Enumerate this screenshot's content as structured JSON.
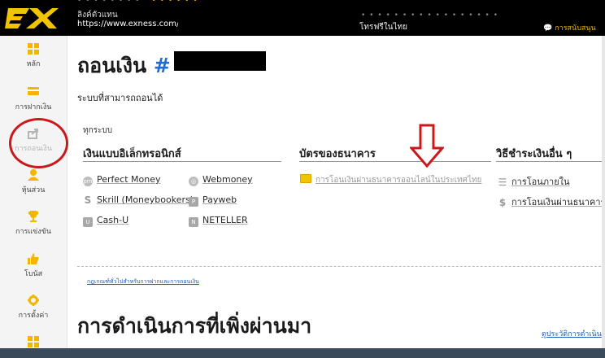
{
  "header": {
    "top_text": "• • • • • • • •",
    "top_text_highlight": "• • • • • •",
    "link_label": "ลิงค์ตัวแทน",
    "link_url": "https://www.exness.com/a",
    "dots": "• • • • • • • • • • • • • • • • •",
    "phone": "โทรฟรีในไทย",
    "support": "การสนับสนุน"
  },
  "sidebar": {
    "items": [
      {
        "label": "หลัก",
        "icon": "grid-icon"
      },
      {
        "label": "การฝากเงิน",
        "icon": "card-icon"
      },
      {
        "label": "การถอนเงิน",
        "icon": "share-out-icon"
      },
      {
        "label": "หุ้นส่วน",
        "icon": "person-icon"
      },
      {
        "label": "การแข่งขัน",
        "icon": "trophy-icon"
      },
      {
        "label": "โบนัส",
        "icon": "thumbs-up-icon"
      },
      {
        "label": "การตั้งค่า",
        "icon": "gear-icon"
      }
    ]
  },
  "main": {
    "title": "ถอนเงิน",
    "title_hash": "#",
    "available_systems": "ระบบที่สามารถถอนได้",
    "all_systems": "ทุกระบบ",
    "columns": [
      {
        "heading": "เงินแบบอิเล็กทรอนิกส์",
        "methods": [
          "Perfect Money",
          "Webmoney",
          "Skrill (Moneybookers)",
          "Payweb",
          "Cash-U",
          "NETELLER"
        ]
      },
      {
        "heading": "บัตรของธนาคาร",
        "methods": [
          "การโอนเงินผ่านธนาคารออนไลน์ในประเทศไทย"
        ]
      },
      {
        "heading": "วิธีชำระเงินอื่น ๆ",
        "methods": [
          "การโอนภายใน",
          "การโอนเงินผ่านธนาคาร"
        ]
      }
    ],
    "guide_link": "กฎเกณฑ์ทั่วไปสำหรับการฝากและการถอนเงิน",
    "recent_title": "การดำเนินการที่เพิ่งผ่านมา",
    "history_link": "ดูประวัติการดำเนิน"
  },
  "colors": {
    "accent": "#f2b600",
    "link": "#1f5bb5",
    "annotation": "#c81a1a"
  }
}
